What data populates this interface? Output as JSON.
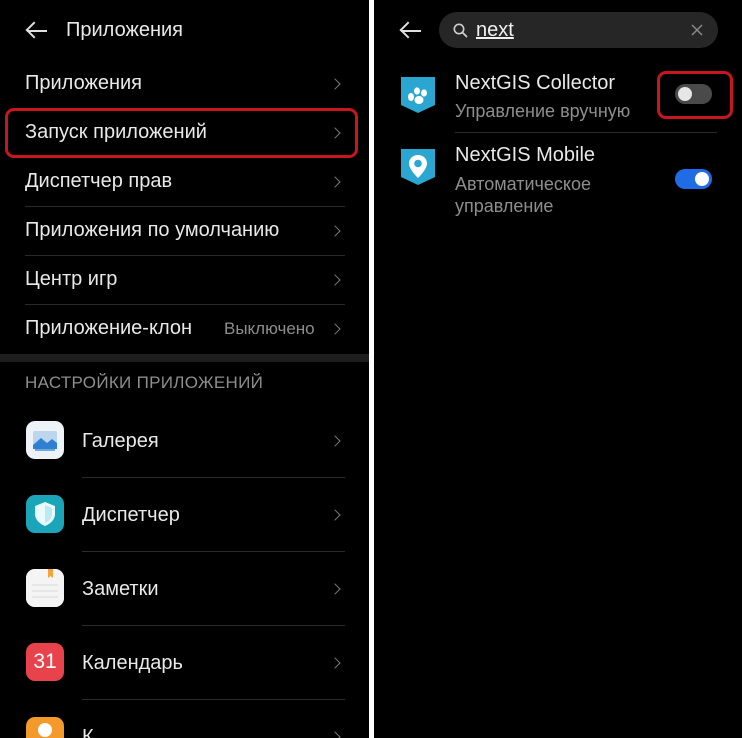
{
  "left": {
    "header": {
      "title": "Приложения"
    },
    "menu": [
      {
        "label": "Приложения",
        "value": ""
      },
      {
        "label": "Запуск приложений",
        "value": ""
      },
      {
        "label": "Диспетчер прав",
        "value": ""
      },
      {
        "label": "Приложения по умолчанию",
        "value": ""
      },
      {
        "label": "Центр игр",
        "value": ""
      },
      {
        "label": "Приложение-клон",
        "value": "Выключено"
      }
    ],
    "section_title": "НАСТРОЙКИ ПРИЛОЖЕНИЙ",
    "apps": [
      {
        "label": "Галерея",
        "icon": "gallery-icon"
      },
      {
        "label": "Диспетчер",
        "icon": "shield-icon"
      },
      {
        "label": "Заметки",
        "icon": "notes-icon"
      },
      {
        "label": "Календарь",
        "icon": "calendar-icon",
        "icon_text": "31"
      },
      {
        "label": "К",
        "icon": "contacts-icon"
      }
    ]
  },
  "right": {
    "search": {
      "value": "next"
    },
    "apps": [
      {
        "name": "NextGIS Collector",
        "status": "Управление вручную",
        "enabled": false,
        "icon": "paw-icon"
      },
      {
        "name": "NextGIS Mobile",
        "status_line1": "Автоматическое",
        "status_line2": "управление",
        "enabled": true,
        "icon": "location-pin-icon"
      }
    ]
  },
  "colors": {
    "background": "#000000",
    "highlight": "#c8161e",
    "toggle_on": "#1f6ce6",
    "toggle_off": "#4a4a4a",
    "nextgis_teal": "#2aa6d0"
  }
}
